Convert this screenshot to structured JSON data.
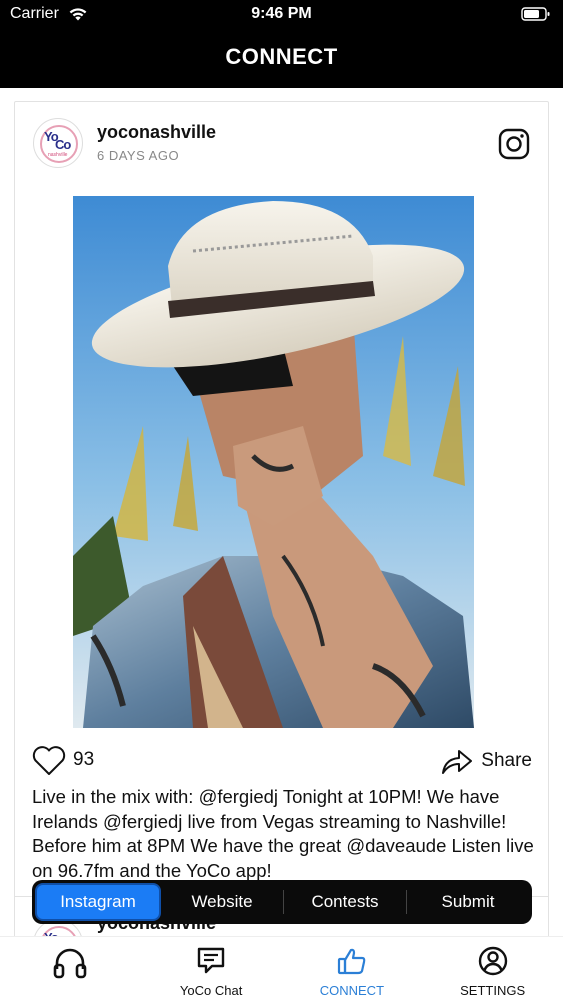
{
  "status_bar": {
    "carrier": "Carrier",
    "time": "9:46 PM"
  },
  "nav": {
    "title": "CONNECT"
  },
  "post": {
    "username": "yoconashville",
    "time_ago": "6 DAYS AGO",
    "likes": "93",
    "share_label": "Share",
    "caption": "Live in the mix with: @fergiedj Tonight at 10PM! We have Irelands @fergiedj live from Vegas streaming to Nashville! Before him at 8PM We have the great @daveaude Listen live on 96.7fm and the YoCo app!"
  },
  "next_post": {
    "username": "yoconashville"
  },
  "segment": {
    "items": [
      {
        "label": "Instagram",
        "active": true
      },
      {
        "label": "Website",
        "active": false
      },
      {
        "label": "Contests",
        "active": false
      },
      {
        "label": "Submit",
        "active": false
      }
    ]
  },
  "tabbar": {
    "items": [
      {
        "label": "",
        "icon": "headphones-icon"
      },
      {
        "label": "YoCo Chat",
        "icon": "chat-icon"
      },
      {
        "label": "CONNECT",
        "icon": "thumbs-up-icon",
        "active": true
      },
      {
        "label": "SETTINGS",
        "icon": "account-icon"
      }
    ]
  },
  "colors": {
    "accent": "#1b7cf5",
    "tab_active": "#2b7fd6",
    "header_bg": "#000000"
  }
}
